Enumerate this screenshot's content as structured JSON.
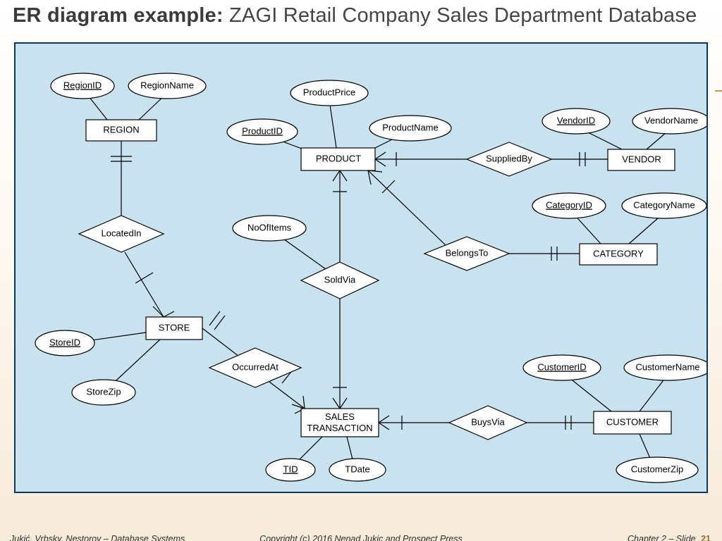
{
  "title": {
    "lead": "ER diagram example:",
    "rest": " ZAGI Retail Company Sales Department Database"
  },
  "entities": {
    "region": "REGION",
    "store": "STORE",
    "product": "PRODUCT",
    "vendor": "VENDOR",
    "category": "CATEGORY",
    "sales_transaction_l1": "SALES",
    "sales_transaction_l2": "TRANSACTION",
    "customer": "CUSTOMER"
  },
  "attributes": {
    "region_id": "RegionID",
    "region_name": "RegionName",
    "store_id": "StoreID",
    "store_zip": "StoreZip",
    "product_id": "ProductID",
    "product_price": "ProductPrice",
    "product_name": "ProductName",
    "no_of_items": "NoOfItems",
    "vendor_id": "VendorID",
    "vendor_name": "VendorName",
    "category_id": "CategoryID",
    "category_name": "CategoryName",
    "tid": "TID",
    "tdate": "TDate",
    "customer_id": "CustomerID",
    "customer_name": "CustomerName",
    "customer_zip": "CustomerZip"
  },
  "relationships": {
    "located_in": "LocatedIn",
    "sold_via": "SoldVia",
    "supplied_by": "SuppliedBy",
    "belongs_to": "BelongsTo",
    "occurred_at": "OccurredAt",
    "buys_via": "BuysVia"
  },
  "footer": {
    "left": "Jukić, Vrbsky, Nestorov – Database Systems",
    "center": "Copyright (c) 2016 Nenad Jukic and Prospect Press",
    "right_label": "Chapter 2 – Slide",
    "right_num": "21"
  }
}
